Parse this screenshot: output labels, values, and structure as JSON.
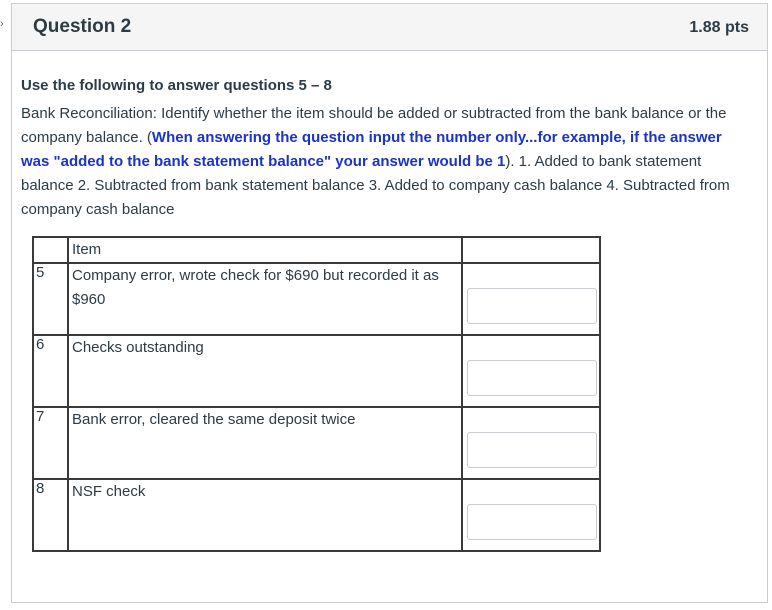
{
  "question": {
    "title": "Question 2",
    "points": "1.88 pts"
  },
  "instructions": {
    "lead": "Use the following to answer questions 5 – 8",
    "text_start": "Bank Reconciliation: Identify whether the item should be added or subtracted from the bank balance or the company balance.  (",
    "text_emphasis": "When answering the question input the number only...for example, if the answer was \"added to the bank statement balance\" your answer would be 1",
    "text_end": "). 1. Added to bank statement balance 2. Subtracted from bank statement balance 3. Added to company cash balance 4. Subtracted from company cash balance"
  },
  "table": {
    "header_item": "Item",
    "rows": [
      {
        "num": "5",
        "item": "Company error, wrote check for $690 but recorded it as $960",
        "answer": ""
      },
      {
        "num": "6",
        "item": "Checks outstanding",
        "answer": ""
      },
      {
        "num": "7",
        "item": "Bank error, cleared the same deposit twice",
        "answer": ""
      },
      {
        "num": "8",
        "item": "NSF check",
        "answer": ""
      }
    ]
  }
}
